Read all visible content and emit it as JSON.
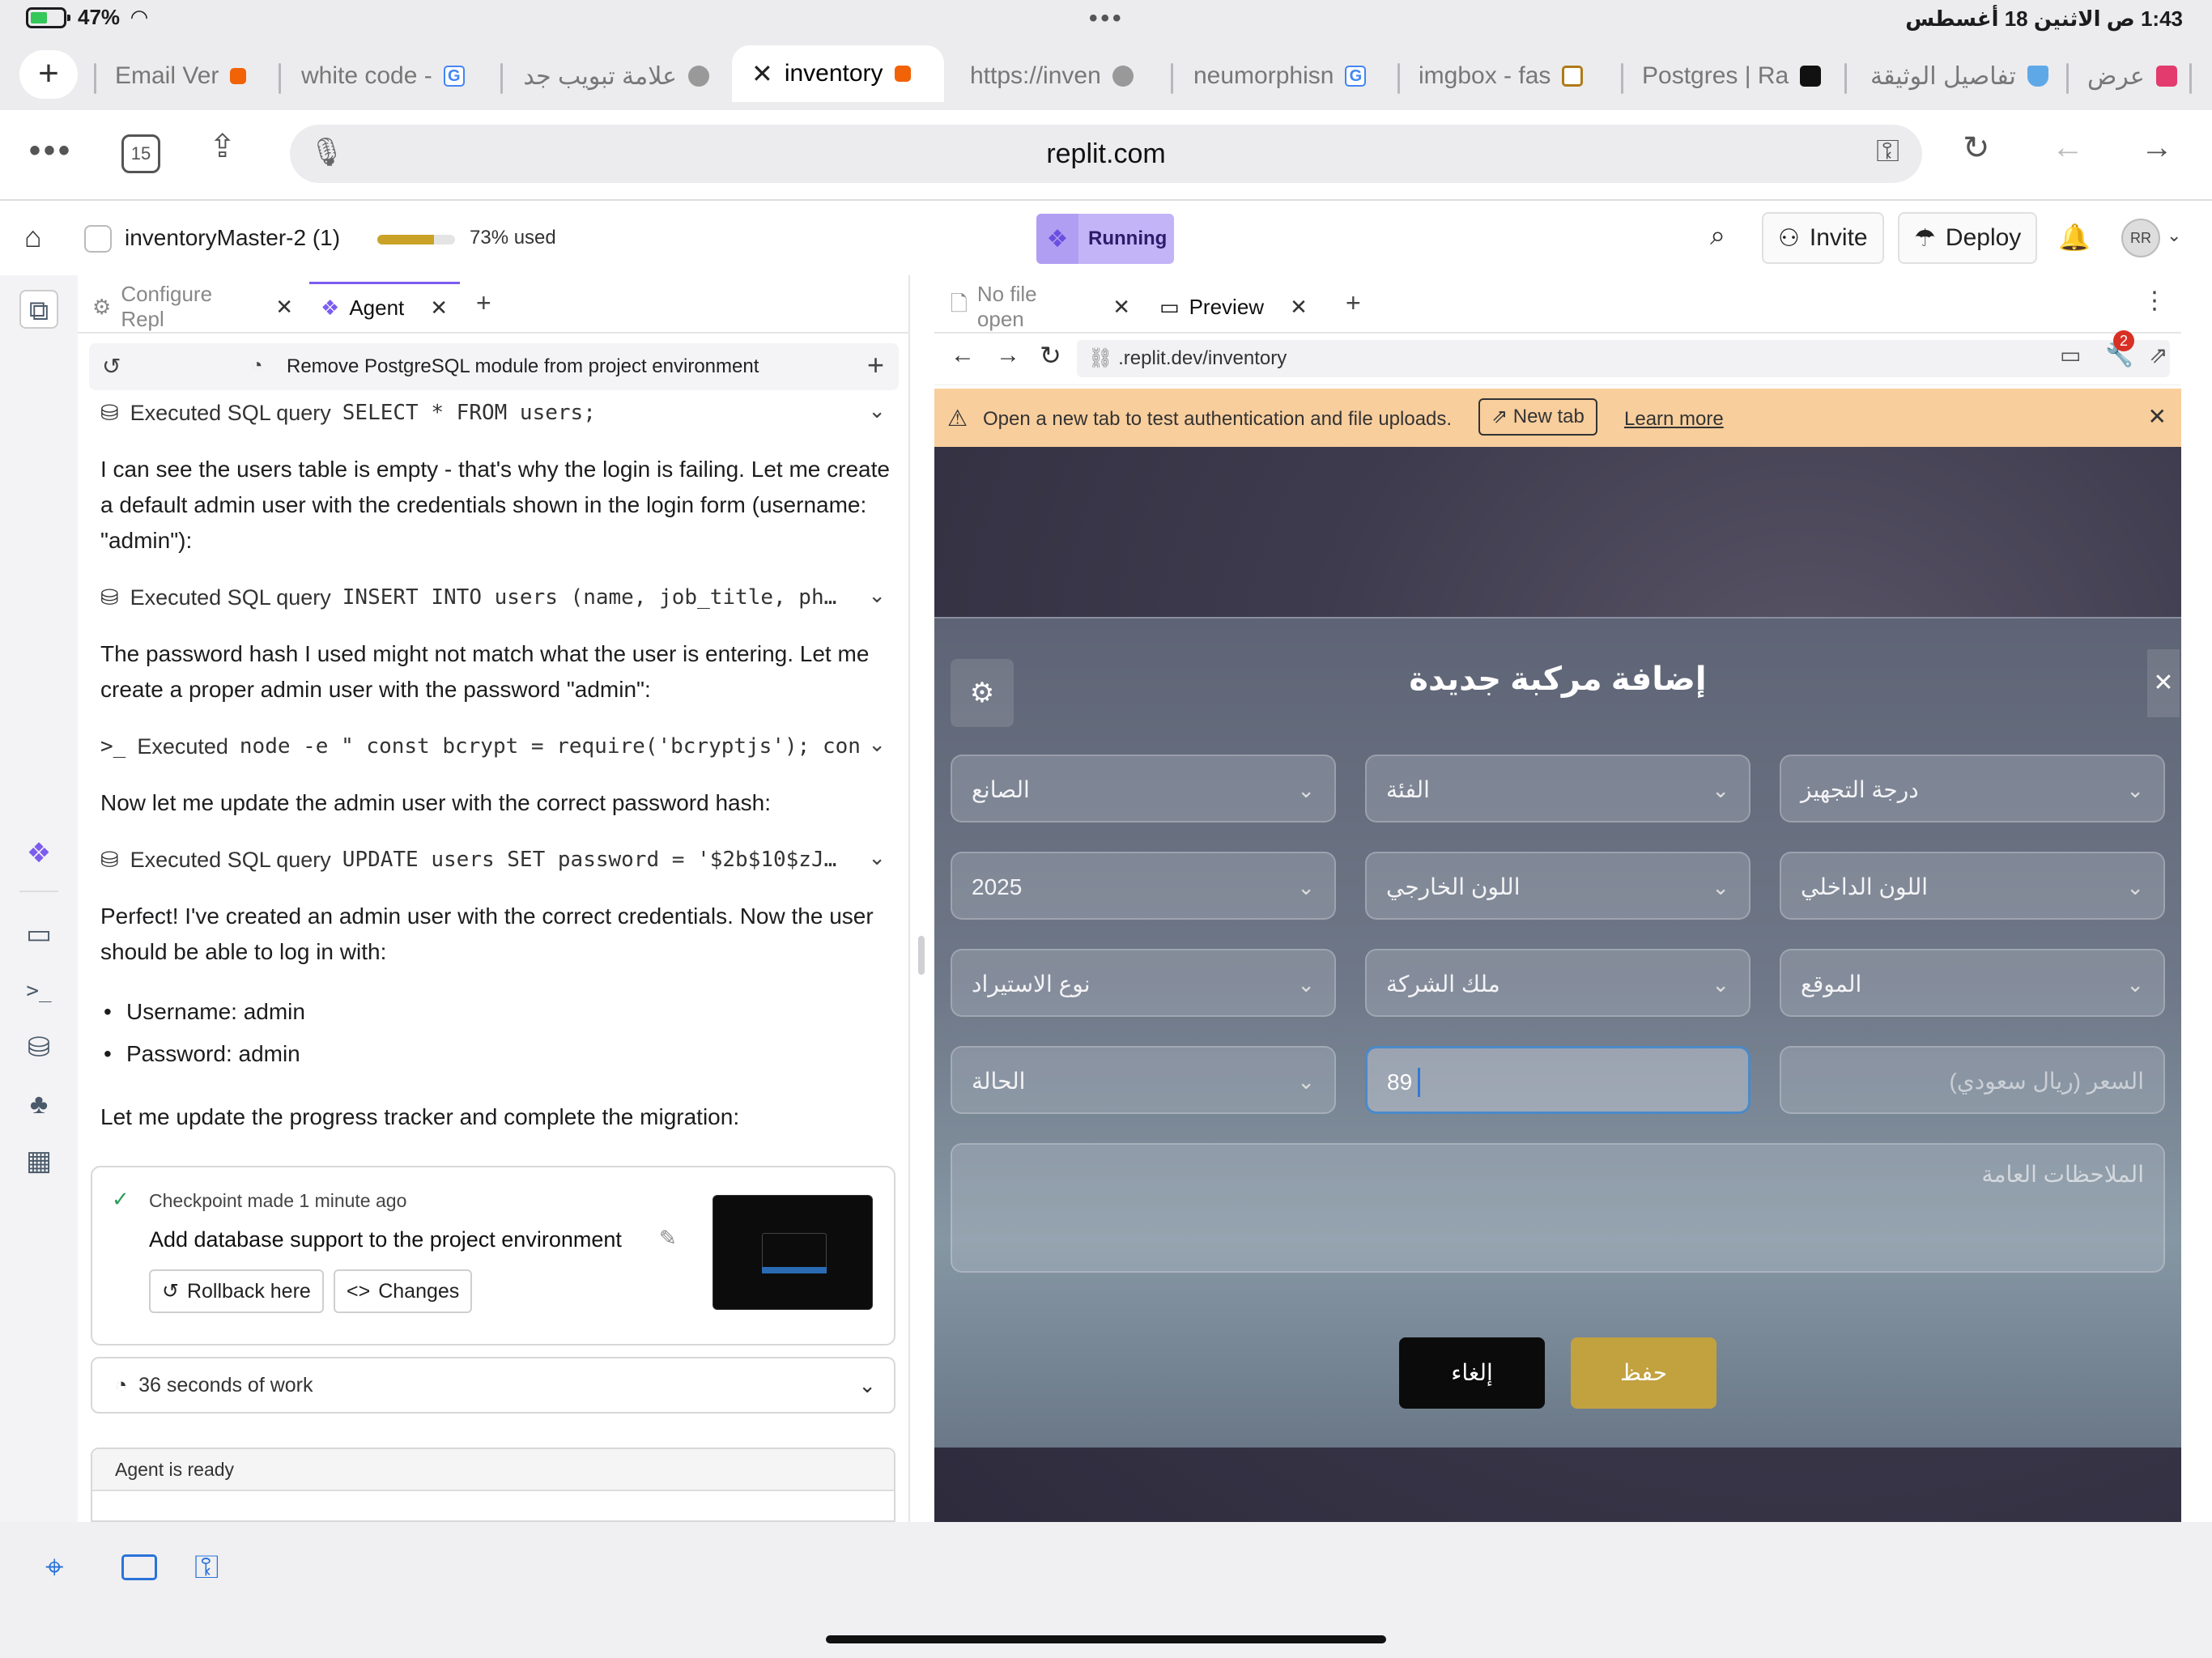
{
  "status_bar": {
    "battery": "47%",
    "datetime": "1:43 ص  الاثنين 18 أغسطس"
  },
  "browser_tabs": [
    {
      "label": "Email Ver",
      "favicon_color": "#f26207"
    },
    {
      "label": "white code -",
      "favicon_color": "#4285f4"
    },
    {
      "label": "علامة تبويب جد",
      "favicon_color": "#888888"
    },
    {
      "label": "inventory",
      "favicon_color": "#f26207",
      "active": true
    },
    {
      "label": "https://inven",
      "favicon_color": "#888888"
    },
    {
      "label": "neumorphisn",
      "favicon_color": "#4285f4"
    },
    {
      "label": "imgbox - fas",
      "favicon_color": "#b07a17"
    },
    {
      "label": "Postgres | Ra",
      "favicon_color": "#111111"
    },
    {
      "label": "تفاصيل الوثيقة",
      "favicon_color": "#5fa8e8"
    },
    {
      "label": "عرض",
      "favicon_color": "#e33b6e"
    }
  ],
  "address_bar": {
    "tab_count": "15",
    "url": "replit.com"
  },
  "replit_header": {
    "project_name": "inventoryMaster-2 (1)",
    "usage_text": "73% used",
    "usage_fraction": 0.73,
    "run_status": "Running",
    "invite_label": "Invite",
    "deploy_label": "Deploy",
    "avatar_initials": "RR"
  },
  "agent_panel": {
    "tabs": [
      "Configure Repl",
      "Agent"
    ],
    "session_title": "Remove PostgreSQL module from project environment",
    "exec1_prefix": "Executed SQL query",
    "exec1_code": "SELECT * FROM users;",
    "msg1": "I can see the users table is empty - that's why the login is failing. Let me create a default admin user with the credentials shown in the login form (username: \"admin\"):",
    "exec2_prefix": "Executed SQL query",
    "exec2_code": "INSERT INTO users (name, job_title, ph…",
    "msg2": "The password hash I used might not match what the user is entering. Let me create a proper admin user with the password \"admin\":",
    "exec3_prefix": "Executed",
    "exec3_code": "node -e \" const bcrypt = require('bcryptjs'); con",
    "msg3": "Now let me update the admin user with the correct password hash:",
    "exec4_prefix": "Executed SQL query",
    "exec4_code": "UPDATE users SET password = '$2b$10$zJ…",
    "msg4": "Perfect! I've created an admin user with the correct credentials. Now the user should be able to log in with:",
    "bullets": [
      "Username: admin",
      "Password: admin"
    ],
    "msg5": "Let me update the progress tracker and complete the migration:",
    "checkpoint_meta": "Checkpoint made 1 minute ago",
    "checkpoint_title": "Add database support to the project environment",
    "rollback_label": "Rollback here",
    "changes_label": "Changes",
    "work_summary": "36 seconds of work",
    "ready_text": "Agent is ready"
  },
  "preview_panel": {
    "tabs": [
      "No file open",
      "Preview"
    ],
    "url": ".replit.dev/inventory",
    "notification_count": "2",
    "warning_text": "Open a new tab to test authentication and file uploads.",
    "new_tab_label": "New tab",
    "learn_more_label": "Learn more"
  },
  "modal": {
    "title": "إضافة مركبة جديدة",
    "fields_row1": [
      "الصانع",
      "الفئة",
      "درجة التجهيز"
    ],
    "fields_row2": [
      "2025",
      "اللون الخارجي",
      "اللون الداخلي"
    ],
    "fields_row3": [
      "نوع الاستيراد",
      "ملك الشركة",
      "الموقع"
    ],
    "status_label": "الحالة",
    "mileage_value": "89",
    "price_placeholder": "السعر (ريال سعودي)",
    "notes_placeholder": "الملاحظات العامة",
    "cancel_label": "إلغاء",
    "save_label": "حفظ"
  },
  "colors": {
    "accent_purple": "#7c5cf0",
    "running_pill": "#c3b4f7",
    "save_gold": "#c2a13f",
    "warning_bg": "#f8ce9d"
  }
}
